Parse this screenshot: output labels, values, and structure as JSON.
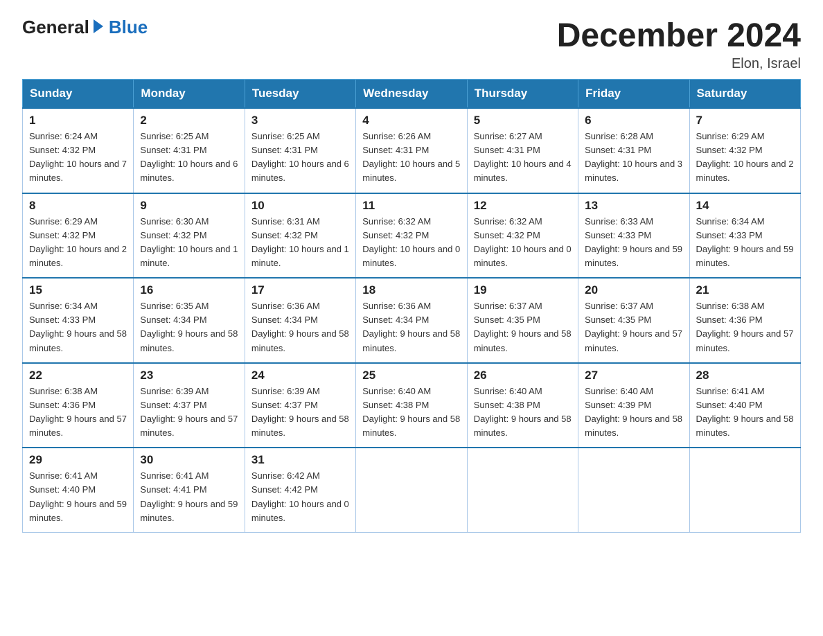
{
  "header": {
    "logo_general": "General",
    "logo_blue": "Blue",
    "title": "December 2024",
    "location": "Elon, Israel"
  },
  "weekdays": [
    "Sunday",
    "Monday",
    "Tuesday",
    "Wednesday",
    "Thursday",
    "Friday",
    "Saturday"
  ],
  "weeks": [
    [
      {
        "date": "1",
        "sunrise": "6:24 AM",
        "sunset": "4:32 PM",
        "daylight": "10 hours and 7 minutes."
      },
      {
        "date": "2",
        "sunrise": "6:25 AM",
        "sunset": "4:31 PM",
        "daylight": "10 hours and 6 minutes."
      },
      {
        "date": "3",
        "sunrise": "6:25 AM",
        "sunset": "4:31 PM",
        "daylight": "10 hours and 6 minutes."
      },
      {
        "date": "4",
        "sunrise": "6:26 AM",
        "sunset": "4:31 PM",
        "daylight": "10 hours and 5 minutes."
      },
      {
        "date": "5",
        "sunrise": "6:27 AM",
        "sunset": "4:31 PM",
        "daylight": "10 hours and 4 minutes."
      },
      {
        "date": "6",
        "sunrise": "6:28 AM",
        "sunset": "4:31 PM",
        "daylight": "10 hours and 3 minutes."
      },
      {
        "date": "7",
        "sunrise": "6:29 AM",
        "sunset": "4:32 PM",
        "daylight": "10 hours and 2 minutes."
      }
    ],
    [
      {
        "date": "8",
        "sunrise": "6:29 AM",
        "sunset": "4:32 PM",
        "daylight": "10 hours and 2 minutes."
      },
      {
        "date": "9",
        "sunrise": "6:30 AM",
        "sunset": "4:32 PM",
        "daylight": "10 hours and 1 minute."
      },
      {
        "date": "10",
        "sunrise": "6:31 AM",
        "sunset": "4:32 PM",
        "daylight": "10 hours and 1 minute."
      },
      {
        "date": "11",
        "sunrise": "6:32 AM",
        "sunset": "4:32 PM",
        "daylight": "10 hours and 0 minutes."
      },
      {
        "date": "12",
        "sunrise": "6:32 AM",
        "sunset": "4:32 PM",
        "daylight": "10 hours and 0 minutes."
      },
      {
        "date": "13",
        "sunrise": "6:33 AM",
        "sunset": "4:33 PM",
        "daylight": "9 hours and 59 minutes."
      },
      {
        "date": "14",
        "sunrise": "6:34 AM",
        "sunset": "4:33 PM",
        "daylight": "9 hours and 59 minutes."
      }
    ],
    [
      {
        "date": "15",
        "sunrise": "6:34 AM",
        "sunset": "4:33 PM",
        "daylight": "9 hours and 58 minutes."
      },
      {
        "date": "16",
        "sunrise": "6:35 AM",
        "sunset": "4:34 PM",
        "daylight": "9 hours and 58 minutes."
      },
      {
        "date": "17",
        "sunrise": "6:36 AM",
        "sunset": "4:34 PM",
        "daylight": "9 hours and 58 minutes."
      },
      {
        "date": "18",
        "sunrise": "6:36 AM",
        "sunset": "4:34 PM",
        "daylight": "9 hours and 58 minutes."
      },
      {
        "date": "19",
        "sunrise": "6:37 AM",
        "sunset": "4:35 PM",
        "daylight": "9 hours and 58 minutes."
      },
      {
        "date": "20",
        "sunrise": "6:37 AM",
        "sunset": "4:35 PM",
        "daylight": "9 hours and 57 minutes."
      },
      {
        "date": "21",
        "sunrise": "6:38 AM",
        "sunset": "4:36 PM",
        "daylight": "9 hours and 57 minutes."
      }
    ],
    [
      {
        "date": "22",
        "sunrise": "6:38 AM",
        "sunset": "4:36 PM",
        "daylight": "9 hours and 57 minutes."
      },
      {
        "date": "23",
        "sunrise": "6:39 AM",
        "sunset": "4:37 PM",
        "daylight": "9 hours and 57 minutes."
      },
      {
        "date": "24",
        "sunrise": "6:39 AM",
        "sunset": "4:37 PM",
        "daylight": "9 hours and 58 minutes."
      },
      {
        "date": "25",
        "sunrise": "6:40 AM",
        "sunset": "4:38 PM",
        "daylight": "9 hours and 58 minutes."
      },
      {
        "date": "26",
        "sunrise": "6:40 AM",
        "sunset": "4:38 PM",
        "daylight": "9 hours and 58 minutes."
      },
      {
        "date": "27",
        "sunrise": "6:40 AM",
        "sunset": "4:39 PM",
        "daylight": "9 hours and 58 minutes."
      },
      {
        "date": "28",
        "sunrise": "6:41 AM",
        "sunset": "4:40 PM",
        "daylight": "9 hours and 58 minutes."
      }
    ],
    [
      {
        "date": "29",
        "sunrise": "6:41 AM",
        "sunset": "4:40 PM",
        "daylight": "9 hours and 59 minutes."
      },
      {
        "date": "30",
        "sunrise": "6:41 AM",
        "sunset": "4:41 PM",
        "daylight": "9 hours and 59 minutes."
      },
      {
        "date": "31",
        "sunrise": "6:42 AM",
        "sunset": "4:42 PM",
        "daylight": "10 hours and 0 minutes."
      },
      null,
      null,
      null,
      null
    ]
  ]
}
